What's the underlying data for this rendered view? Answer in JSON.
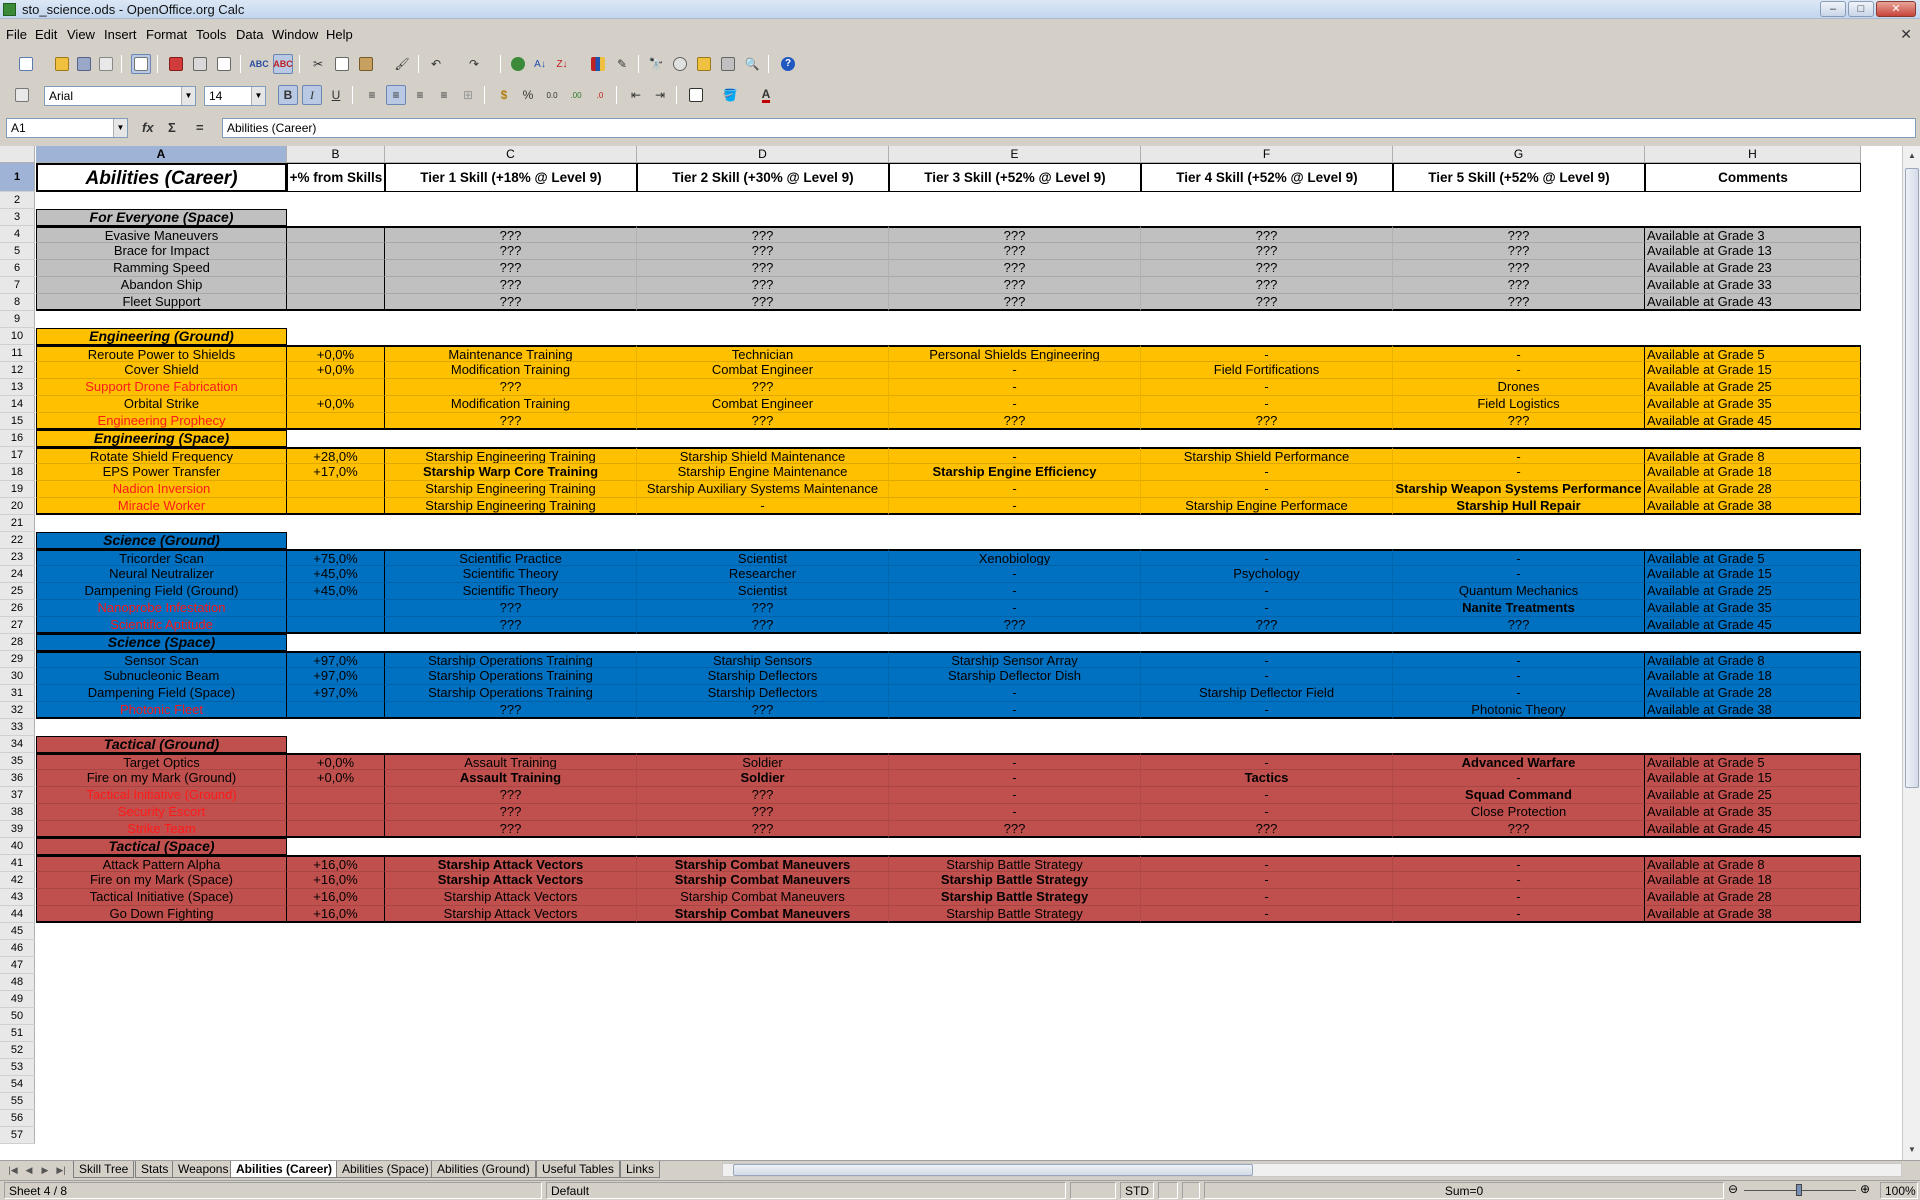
{
  "window": {
    "title": "sto_science.ods - OpenOffice.org Calc",
    "minimize_icon": "minimize-icon",
    "maximize_icon": "maximize-icon",
    "close_icon": "close-icon"
  },
  "menu": [
    "File",
    "Edit",
    "View",
    "Insert",
    "Format",
    "Tools",
    "Data",
    "Window",
    "Help"
  ],
  "format_toolbar": {
    "font_name": "Arial",
    "font_size": "14"
  },
  "formula_bar": {
    "cell_ref": "A1",
    "content": "Abilities (Career)"
  },
  "columns": [
    "A",
    "B",
    "C",
    "D",
    "E",
    "F",
    "G",
    "H"
  ],
  "colors": {
    "space_gray": "#c0c0c0",
    "engineering_orange": "#ffc000",
    "science_blue": "#0070c0",
    "tactical_red": "#c0504d",
    "text_red": "#ff1a1a",
    "selection_blue": "#9fb3d6"
  },
  "sheet": {
    "header": [
      "Abilities (Career)",
      "+% from Skills",
      "Tier 1 Skill (+18% @ Level 9)",
      "Tier 2 Skill (+30% @ Level 9)",
      "Tier 3 Skill (+52% @ Level 9)",
      "Tier 4 Skill (+52% @ Level 9)",
      "Tier 5 Skill (+52% @ Level 9)",
      "Comments"
    ],
    "sections": [
      {
        "title": "For Everyone (Space)",
        "row": 3,
        "group": "space_gray",
        "rows": [
          {
            "n": 4,
            "cells": [
              "Evasive Maneuvers",
              "",
              "???",
              "???",
              "???",
              "???",
              "???",
              "Available at Grade 3"
            ]
          },
          {
            "n": 5,
            "cells": [
              "Brace for Impact",
              "",
              "???",
              "???",
              "???",
              "???",
              "???",
              "Available at Grade 13"
            ]
          },
          {
            "n": 6,
            "cells": [
              "Ramming Speed",
              "",
              "???",
              "???",
              "???",
              "???",
              "???",
              "Available at Grade 23"
            ]
          },
          {
            "n": 7,
            "cells": [
              "Abandon Ship",
              "",
              "???",
              "???",
              "???",
              "???",
              "???",
              "Available at Grade 33"
            ]
          },
          {
            "n": 8,
            "cells": [
              "Fleet Support",
              "",
              "???",
              "???",
              "???",
              "???",
              "???",
              "Available at Grade 43"
            ]
          }
        ]
      },
      {
        "title": "Engineering (Ground)",
        "row": 10,
        "group": "engineering_orange",
        "rows": [
          {
            "n": 11,
            "cells": [
              "Reroute Power to Shields",
              "+0,0%",
              "Maintenance Training",
              "Technician",
              "Personal Shields Engineering",
              "-",
              "-",
              "Available at Grade 5"
            ]
          },
          {
            "n": 12,
            "cells": [
              "Cover Shield",
              "+0,0%",
              "Modification Training",
              "Combat Engineer",
              "-",
              "Field Fortifications",
              "-",
              "Available at Grade 15"
            ]
          },
          {
            "n": 13,
            "red": true,
            "cells": [
              "Support Drone Fabrication",
              "",
              "???",
              "???",
              "-",
              "-",
              "Drones",
              "Available at Grade 25"
            ]
          },
          {
            "n": 14,
            "cells": [
              "Orbital Strike",
              "+0,0%",
              "Modification Training",
              "Combat Engineer",
              "-",
              "-",
              "Field Logistics",
              "Available at Grade 35"
            ]
          },
          {
            "n": 15,
            "red": true,
            "cells": [
              "Engineering Prophecy",
              "",
              "???",
              "???",
              "???",
              "???",
              "???",
              "Available at Grade 45"
            ]
          }
        ]
      },
      {
        "title": "Engineering (Space)",
        "row": 16,
        "group": "engineering_orange",
        "rows": [
          {
            "n": 17,
            "cells": [
              "Rotate Shield Frequency",
              "+28,0%",
              "Starship Engineering Training",
              "Starship Shield Maintenance",
              "-",
              "Starship Shield Performance",
              "-",
              "Available at Grade 8"
            ]
          },
          {
            "n": 18,
            "bold": [
              2,
              4
            ],
            "cells": [
              "EPS Power Transfer",
              "+17,0%",
              "Starship Warp Core Training",
              "Starship Engine Maintenance",
              "Starship Engine Efficiency",
              "-",
              "-",
              "Available at Grade 18"
            ]
          },
          {
            "n": 19,
            "red": true,
            "bold": [
              6
            ],
            "cells": [
              "Nadion Inversion",
              "",
              "Starship Engineering Training",
              "Starship Auxiliary Systems Maintenance",
              "-",
              "-",
              "Starship Weapon Systems Performance",
              "Available at Grade 28"
            ]
          },
          {
            "n": 20,
            "red": true,
            "bold": [
              6
            ],
            "cells": [
              "Miracle Worker",
              "",
              "Starship Engineering Training",
              "-",
              "-",
              "Starship Engine Performace",
              "Starship Hull Repair",
              "Available at Grade 38"
            ]
          }
        ]
      },
      {
        "title": "Science (Ground)",
        "row": 22,
        "group": "science_blue",
        "rows": [
          {
            "n": 23,
            "cells": [
              "Tricorder Scan",
              "+75,0%",
              "Scientific Practice",
              "Scientist",
              "Xenobiology",
              "-",
              "-",
              "Available at Grade 5"
            ]
          },
          {
            "n": 24,
            "cells": [
              "Neural Neutralizer",
              "+45,0%",
              "Scientific Theory",
              "Researcher",
              "-",
              "Psychology",
              "-",
              "Available at Grade 15"
            ]
          },
          {
            "n": 25,
            "cells": [
              "Dampening Field (Ground)",
              "+45,0%",
              "Scientific Theory",
              "Scientist",
              "-",
              "-",
              "Quantum Mechanics",
              "Available at Grade 25"
            ]
          },
          {
            "n": 26,
            "red": true,
            "bold": [
              6
            ],
            "cells": [
              "Nanoprobe Infestation",
              "",
              "???",
              "???",
              "-",
              "-",
              "Nanite Treatments",
              "Available at Grade 35"
            ]
          },
          {
            "n": 27,
            "red": true,
            "cells": [
              "Scientific Aptitude",
              "",
              "???",
              "???",
              "???",
              "???",
              "???",
              "Available at Grade 45"
            ]
          }
        ]
      },
      {
        "title": "Science (Space)",
        "row": 28,
        "group": "science_blue",
        "rows": [
          {
            "n": 29,
            "cells": [
              "Sensor Scan",
              "+97,0%",
              "Starship Operations Training",
              "Starship Sensors",
              "Starship Sensor Array",
              "-",
              "-",
              "Available at Grade 8"
            ]
          },
          {
            "n": 30,
            "cells": [
              "Subnucleonic Beam",
              "+97,0%",
              "Starship Operations Training",
              "Starship Deflectors",
              "Starship Deflector Dish",
              "-",
              "-",
              "Available at Grade 18"
            ]
          },
          {
            "n": 31,
            "cells": [
              "Dampening Field (Space)",
              "+97,0%",
              "Starship Operations Training",
              "Starship Deflectors",
              "-",
              "Starship Deflector Field",
              "-",
              "Available at Grade 28"
            ]
          },
          {
            "n": 32,
            "red": true,
            "cells": [
              "Photonic Fleet",
              "",
              "???",
              "???",
              "-",
              "-",
              "Photonic Theory",
              "Available at Grade 38"
            ]
          }
        ]
      },
      {
        "title": "Tactical (Ground)",
        "row": 34,
        "group": "tactical_red",
        "rows": [
          {
            "n": 35,
            "bold": [
              6
            ],
            "cells": [
              "Target Optics",
              "+0,0%",
              "Assault Training",
              "Soldier",
              "-",
              "-",
              "Advanced Warfare",
              "Available at Grade 5"
            ]
          },
          {
            "n": 36,
            "bold": [
              2,
              3,
              5
            ],
            "cells": [
              "Fire on my Mark (Ground)",
              "+0,0%",
              "Assault Training",
              "Soldier",
              "-",
              "Tactics",
              "-",
              "Available at Grade 15"
            ]
          },
          {
            "n": 37,
            "red": true,
            "bold": [
              6
            ],
            "cells": [
              "Tactical Initiative (Ground)",
              "",
              "???",
              "???",
              "-",
              "-",
              "Squad Command",
              "Available at Grade 25"
            ]
          },
          {
            "n": 38,
            "red": true,
            "cells": [
              "Security Escort",
              "",
              "???",
              "???",
              "-",
              "-",
              "Close Protection",
              "Available at Grade 35"
            ]
          },
          {
            "n": 39,
            "red": true,
            "cells": [
              "Strike Team",
              "",
              "???",
              "???",
              "???",
              "???",
              "???",
              "Available at Grade 45"
            ]
          }
        ]
      },
      {
        "title": "Tactical (Space)",
        "row": 40,
        "group": "tactical_red",
        "rows": [
          {
            "n": 41,
            "bold": [
              2,
              3
            ],
            "cells": [
              "Attack Pattern Alpha",
              "+16,0%",
              "Starship Attack Vectors",
              "Starship Combat Maneuvers",
              "Starship Battle Strategy",
              "-",
              "-",
              "Available at Grade 8"
            ]
          },
          {
            "n": 42,
            "bold": [
              2,
              3,
              4
            ],
            "cells": [
              "Fire on my Mark (Space)",
              "+16,0%",
              "Starship Attack Vectors",
              "Starship Combat Maneuvers",
              "Starship Battle Strategy",
              "-",
              "-",
              "Available at Grade 18"
            ]
          },
          {
            "n": 43,
            "bold": [
              4
            ],
            "cells": [
              "Tactical Initiative (Space)",
              "+16,0%",
              "Starship Attack Vectors",
              "Starship Combat Maneuvers",
              "Starship Battle Strategy",
              "-",
              "-",
              "Available at Grade 28"
            ]
          },
          {
            "n": 44,
            "bold": [
              3
            ],
            "cells": [
              "Go Down Fighting",
              "+16,0%",
              "Starship Attack Vectors",
              "Starship Combat Maneuvers",
              "Starship Battle Strategy",
              "-",
              "-",
              "Available at Grade 38"
            ]
          }
        ]
      }
    ],
    "visible_row_count": 57
  },
  "tabs": [
    "Skill Tree",
    "Stats",
    "Weapons",
    "Abilities (Career)",
    "Abilities (Space)",
    "Abilities (Ground)",
    "Useful Tables",
    "Links"
  ],
  "active_tab": "Abilities (Career)",
  "statusbar": {
    "sheet": "Sheet 4 / 8",
    "style": "Default",
    "mode": "STD",
    "sum": "Sum=0",
    "zoom": "100%"
  }
}
